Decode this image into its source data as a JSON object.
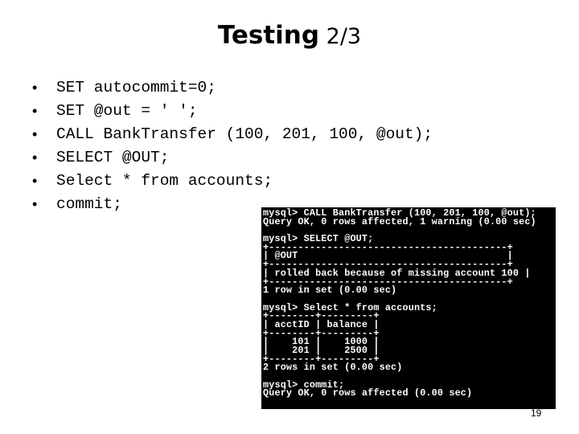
{
  "slide": {
    "title_main": "Testing",
    "title_sub": " 2/3",
    "bullet_glyph": "•",
    "bullets": [
      "SET autocommit=0;",
      "SET @out = ' ';",
      "CALL BankTransfer (100, 201, 100, @out);",
      "SELECT @OUT;",
      "Select * from accounts;",
      "commit;"
    ],
    "page_number": "19"
  },
  "terminal": {
    "lines": [
      "mysql> CALL BankTransfer (100, 201, 100, @out);",
      "Query OK, 0 rows affected, 1 warning (0.00 sec)",
      "",
      "mysql> SELECT @OUT;",
      "+-----------------------------------------+",
      "| @OUT                                    |",
      "+-----------------------------------------+",
      "| rolled back because of missing account 100 |",
      "+-----------------------------------------+",
      "1 row in set (0.00 sec)",
      "",
      "mysql> Select * from accounts;",
      "+--------+---------+",
      "| acctID | balance |",
      "+--------+---------+",
      "|    101 |    1000 |",
      "|    201 |    2500 |",
      "+--------+---------+",
      "2 rows in set (0.00 sec)",
      "",
      "mysql> commit;",
      "Query OK, 0 rows affected (0.00 sec)"
    ]
  }
}
